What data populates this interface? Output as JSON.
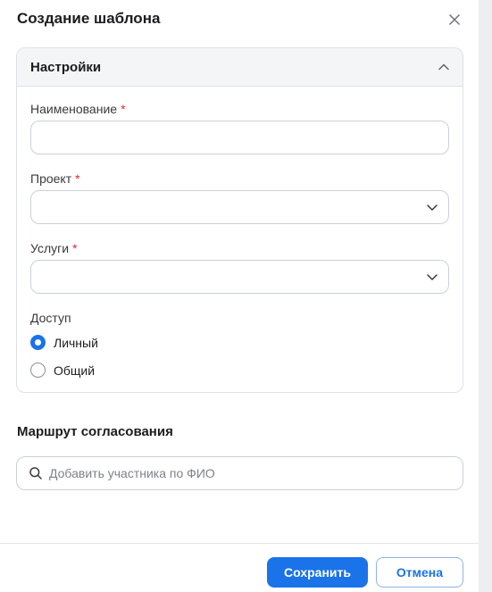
{
  "dialog": {
    "title": "Создание шаблона"
  },
  "settings": {
    "title": "Настройки",
    "fields": {
      "name": {
        "label": "Наименование",
        "required_mark": "*",
        "value": ""
      },
      "project": {
        "label": "Проект",
        "required_mark": "*",
        "value": ""
      },
      "services": {
        "label": "Услуги",
        "required_mark": "*",
        "value": ""
      }
    },
    "access": {
      "label": "Доступ",
      "options": [
        {
          "label": "Личный",
          "selected": true
        },
        {
          "label": "Общий",
          "selected": false
        }
      ]
    }
  },
  "route": {
    "title": "Маршрут согласования",
    "search_placeholder": "Добавить участника по ФИО"
  },
  "footer": {
    "save_label": "Сохранить",
    "cancel_label": "Отмена"
  },
  "colors": {
    "accent": "#1a73e8",
    "required": "#e0262e"
  },
  "icons": {
    "close": "close-icon",
    "collapse": "chevron-up-icon",
    "dropdown": "chevron-down-icon",
    "search": "search-icon"
  }
}
